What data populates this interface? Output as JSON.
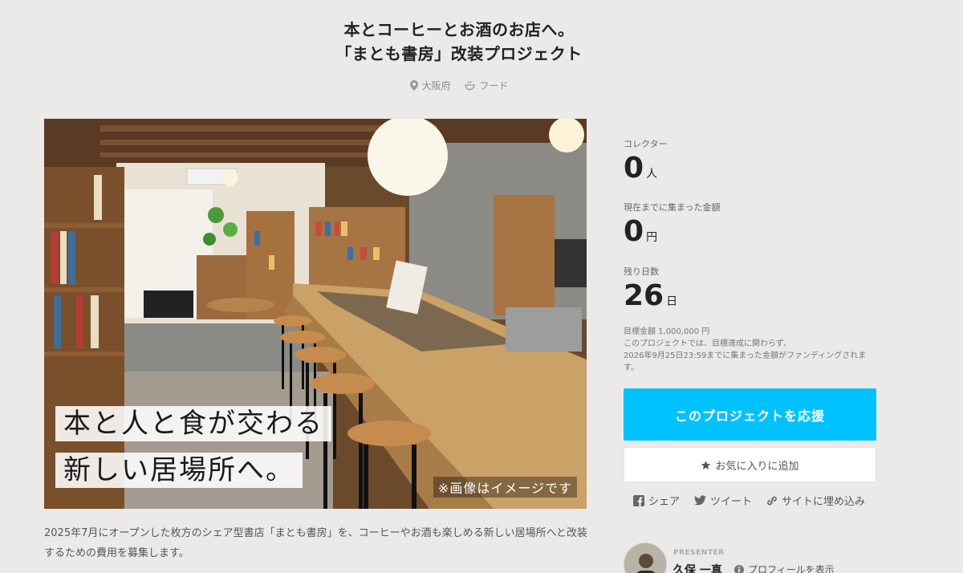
{
  "header": {
    "title_line1": "本とコーヒーとお酒のお店へ。",
    "title_line2": "「まとも書房」改装プロジェクト",
    "location": "大阪府",
    "location_icon": "map-pin-icon",
    "category": "フード",
    "category_icon": "food-bowl-icon"
  },
  "hero": {
    "catch_line1": "本と人と食が交わる",
    "catch_line2": "新しい居場所へ。",
    "note": "※画像はイメージです"
  },
  "description": "2025年7月にオープンした枚方のシェア型書店「まとも書房」を、コーヒーやお酒も楽しめる新しい居場所へと改装するための費用を募集します。",
  "stats": {
    "collectors_label": "コレクター",
    "collectors_value": "0",
    "collectors_unit": "人",
    "raised_label": "現在までに集まった金額",
    "raised_value": "0",
    "raised_unit": "円",
    "days_label": "残り日数",
    "days_value": "26",
    "days_unit": "日"
  },
  "goal": {
    "amount_text": "目標金額 1,000,000 円",
    "note_line1": "このプロジェクトでは、目標達成に関わらず、",
    "note_line2": "2026年9月25日23:59までに集まった金額がファンディングされま",
    "note_line3": "す。"
  },
  "actions": {
    "support_label": "このプロジェクトを応援",
    "favorite_label": "お気に入りに追加",
    "favorite_icon": "star-icon"
  },
  "share": {
    "facebook_label": "シェア",
    "twitter_label": "ツイート",
    "embed_label": "サイトに埋め込み"
  },
  "presenter": {
    "label": "PRESENTER",
    "name": "久保 一真",
    "profile_link": "プロフィールを表示"
  },
  "colors": {
    "background": "#ebeae9",
    "support_button": "#00c2ff",
    "text": "#222222"
  }
}
